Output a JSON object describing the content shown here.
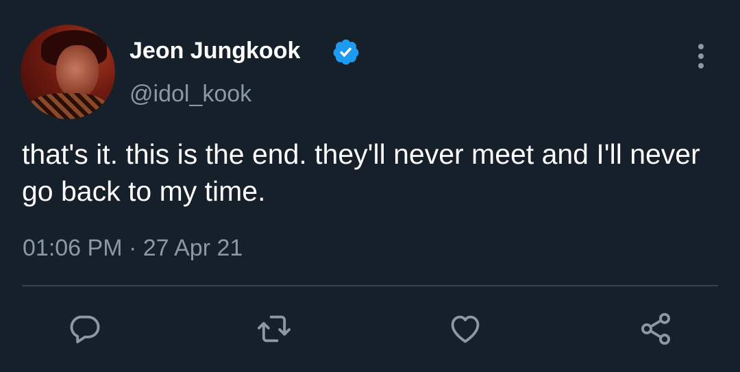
{
  "tweet": {
    "display_name": "Jeon Jungkook",
    "handle": "@idol_kook",
    "text": "that's it. this is the end. they'll never meet and I'll never go back to my time.",
    "timestamp": "01:06 PM · 27 Apr 21",
    "verified": true
  },
  "icons": {
    "verified": "verified-badge-icon",
    "more": "more-vertical-icon",
    "reply": "reply-icon",
    "retweet": "retweet-icon",
    "like": "heart-icon",
    "share": "share-icon"
  },
  "colors": {
    "background": "#15202b",
    "text_primary": "#ffffff",
    "text_secondary": "#8b98a5",
    "accent": "#1d9bf0",
    "divider": "#38444d"
  }
}
